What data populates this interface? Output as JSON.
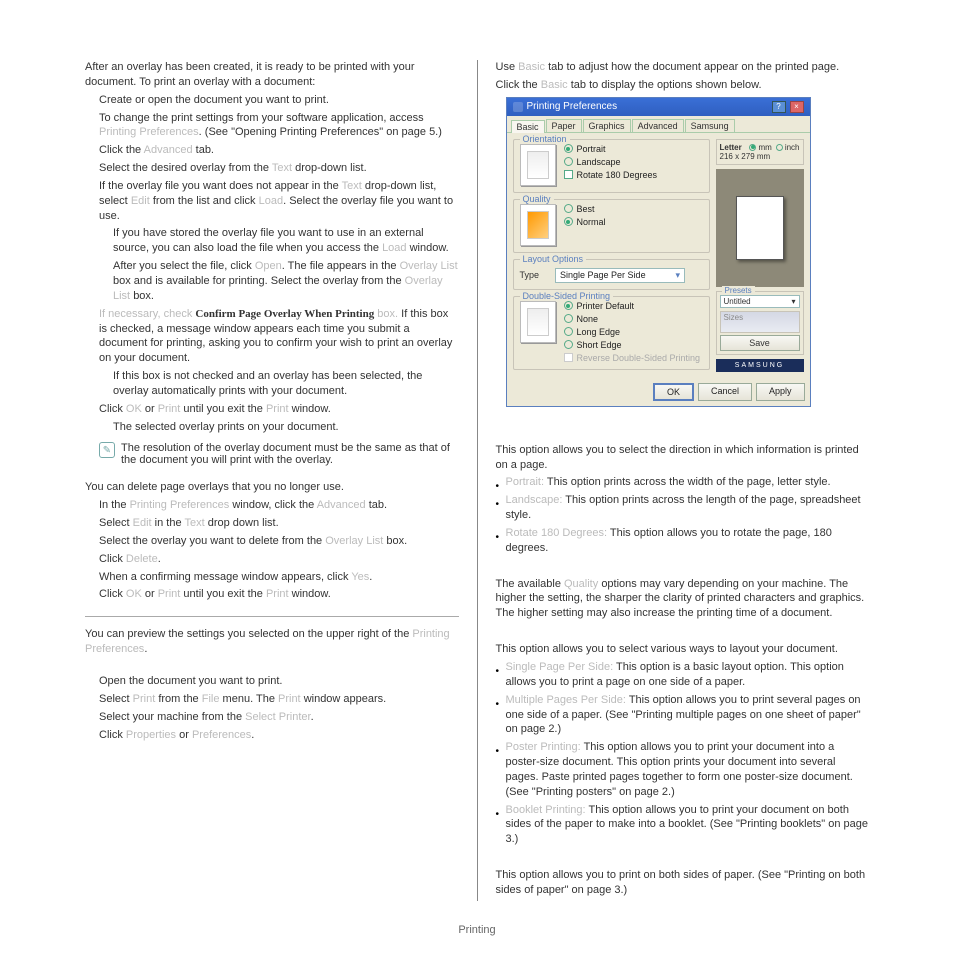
{
  "footer": "Printing",
  "left": {
    "intro1": "After an overlay has been created, it is ready to be printed with your document. To print an overlay with a document:",
    "s1": "Create or open the document you want to print.",
    "s2a": "To change the print settings from your software application, access",
    "s2b": ". (See \"Opening Printing Preferences\" on page 5.)",
    "s3a": "Click the",
    "s3b": "tab.",
    "s4a": "Select the desired overlay from the",
    "s4b": "drop-down list.",
    "s5a": "If the overlay file you want does not appear in the",
    "s5b": "drop-down list, select",
    "s5c": "from the list and click",
    "s5d": ". Select the overlay file you want to use.",
    "s6": "If you have stored the overlay file you want to use in an external source, you can also load the file when you access the",
    "s6b": "window.",
    "s7a": "After you select the file, click",
    "s7b": ". The file appears in the",
    "s7c": "box and is available for printing. Select the overlay from the",
    "s7d": "box.",
    "s8pre": "If necessary, check ",
    "s8bold": "Confirm Page Overlay When Printing",
    "s8post": " box. If this box is checked, a message window appears each time you submit a document for printing, asking you to confirm your wish to print an overlay on your document.",
    "s9": "If this box is not checked and an overlay has been selected, the overlay automatically prints with your document.",
    "s10a": "Click",
    "s10b": "or",
    "s10c": "until you exit the",
    "s10d": "window.",
    "s11": "The selected overlay prints on your document.",
    "note": "The resolution of the overlay document must be the same as that of the document you will print with the overlay.",
    "del_intro": "You can delete page overlays that you no longer use.",
    "d1a": "In the",
    "d1b": "window, click the",
    "d1c": "tab.",
    "d2a": "Select",
    "d2b": "in the",
    "d2c": "drop down list.",
    "d3a": "Select the overlay you want to delete from the",
    "d3b": "box.",
    "d4": "Click",
    "d4b": ".",
    "d5": "When a confirming message window appears, click",
    "d5b": ".",
    "d6a": "Click",
    "d6b": "or",
    "d6c": "until you exit the",
    "d6d": "window.",
    "prev1": "You can preview the settings you selected on the upper right of the",
    "prev1b": ".",
    "p1": "Open the document you want to print.",
    "p2a": "Select",
    "p2b": "from the",
    "p2c": "menu. The",
    "p2d": "window appears.",
    "p3a": "Select your machine from the",
    "p3b": ".",
    "p4a": "Click",
    "p4b": "or",
    "p4c": "."
  },
  "right": {
    "top1a": "Use",
    "top1b": "tab to adjust how the document appear on the printed page.",
    "top2a": "Click the",
    "top2b": "tab to display the options shown below.",
    "dlg": {
      "title": "Printing Preferences",
      "tabs": [
        "Basic",
        "Paper",
        "Graphics",
        "Advanced",
        "Samsung"
      ],
      "orientation": "Orientation",
      "portrait": "Portrait",
      "landscape": "Landscape",
      "rotate": "Rotate 180 Degrees",
      "quality": "Quality",
      "best": "Best",
      "normal": "Normal",
      "layout": "Layout Options",
      "typeLabel": "Type",
      "typeVal": "Single Page Per Side",
      "dsp": "Double-Sided Printing",
      "pdef": "Printer Default",
      "none": "None",
      "long": "Long Edge",
      "short": "Short Edge",
      "rev": "Reverse Double-Sided Printing",
      "paperName": "Letter",
      "paperSize": "216 x 279 mm",
      "mm": "mm",
      "inch": "inch",
      "presets": "Presets",
      "untitled": "Untitled",
      "save": "Save",
      "brand": "SAMSUNG",
      "ok": "OK",
      "cancel": "Cancel",
      "apply": "Apply",
      "sizes": "Sizes"
    },
    "orient_p": "This option allows you to select the direction in which information is printed on a page.",
    "orient_b1": "This option prints across the width of the page, letter style.",
    "orient_b2": "This option prints across the length of the page, spreadsheet style.",
    "orient_b3": "This option allows you to rotate the page, 180 degrees.",
    "qual_p": "The available",
    "qual_p2": "options may vary depending on your machine. The higher the setting, the sharper the clarity of printed characters and graphics. The higher setting may also increase the printing time of a document.",
    "lay_p": "This option allows you to select various ways to layout your document.",
    "lay_b1": "This option is a basic layout option. This option allows you to print a page on one side of a paper.",
    "lay_b2": "This option allows you to print several pages on one side of a paper. (See \"Printing multiple pages on one sheet of paper\" on page 2.)",
    "lay_b3": "This option allows you to print your document into a poster-size document. This option prints your document into several pages. Paste printed pages together to form one poster-size document. (See \"Printing posters\" on page 2.)",
    "lay_b4": "This option allows you to print your document on both sides of the paper to make into a booklet. (See \"Printing booklets\" on page 3.)",
    "dsp_p": "This option allows you to print on both sides of paper. (See \"Printing on both sides of paper\" on page 3.)"
  }
}
